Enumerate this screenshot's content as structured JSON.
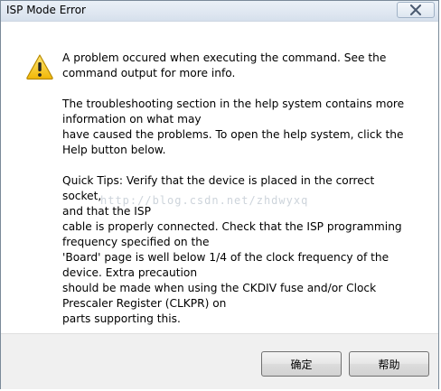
{
  "window": {
    "title": "ISP Mode Error",
    "close_icon": "close-icon"
  },
  "dialog": {
    "icon": "warning-icon",
    "paragraphs": [
      "A problem occured when executing the command. See the\ncommand output for more info.",
      "The troubleshooting section in the help system contains more\ninformation on what may\nhave caused the problems. To open the help system, click the\nHelp button below.",
      "Quick Tips: Verify that the device is placed in the correct socket,\nand that the ISP\ncable is properly connected. Check that the ISP programming\nfrequency specified on the\n'Board' page is well below 1/4 of the clock frequency of the\ndevice. Extra precaution\nshould be made when using the CKDIV fuse and/or Clock\nPrescaler Register (CLKPR) on\nparts supporting this."
    ],
    "watermark": "http://blog.csdn.net/zhdwyxq"
  },
  "buttons": {
    "ok_label": "确定",
    "help_label": "帮助"
  },
  "colors": {
    "titlebar": "#dfe7f1",
    "footer": "#f0f0f0",
    "warning_fill": "#f5c518"
  }
}
